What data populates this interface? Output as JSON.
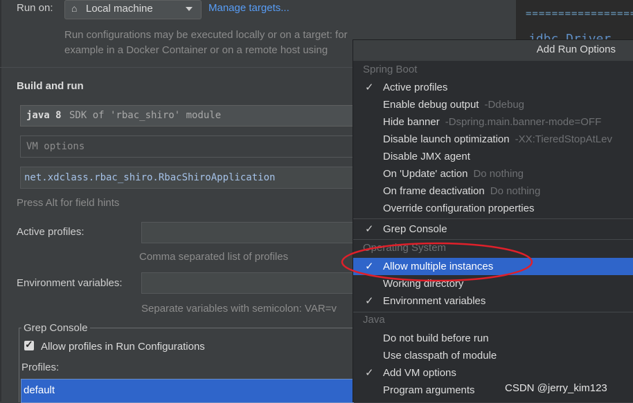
{
  "run_on": {
    "label": "Run on:",
    "target_value": "Local machine",
    "manage_link": "Manage targets...",
    "description_line1": "Run configurations may be executed locally or on a target: for",
    "description_line2": "example in a Docker Container or on a remote host using"
  },
  "build_and_run": {
    "heading": "Build and run",
    "sdk_prefix": "java 8",
    "sdk_rest": "SDK of 'rbac_shiro' module",
    "vm_options_placeholder": "VM options",
    "main_class": "net.xdclass.rbac_shiro.RbacShiroApplication",
    "field_hint": "Press Alt for field hints"
  },
  "active_profiles": {
    "label": "Active profiles:",
    "hint": "Comma separated list of profiles"
  },
  "environment_variables": {
    "label": "Environment variables:",
    "hint": "Separate variables with semicolon: VAR=v"
  },
  "grep_console": {
    "legend": "Grep Console",
    "allow_profiles_label": "Allow profiles in Run Configurations",
    "profiles_label": "Profiles:",
    "profile_selected": "default"
  },
  "editor": {
    "line1": "=====================",
    "line2": "jdbc.Driver"
  },
  "popup": {
    "title": "Add Run Options",
    "sections": {
      "spring_boot": "Spring Boot",
      "operating_system": "Operating System",
      "java": "Java"
    },
    "items": {
      "active_profiles": "Active profiles",
      "enable_debug_output": "Enable debug output",
      "enable_debug_output_hint": "-Ddebug",
      "hide_banner": "Hide banner",
      "hide_banner_hint": "-Dspring.main.banner-mode=OFF",
      "disable_launch_opt": "Disable launch optimization",
      "disable_launch_opt_hint": "-XX:TieredStopAtLev",
      "disable_jmx": "Disable JMX agent",
      "on_update": "On 'Update' action",
      "on_update_hint": "Do nothing",
      "on_frame": "On frame deactivation",
      "on_frame_hint": "Do nothing",
      "override_props": "Override configuration properties",
      "grep_console": "Grep Console",
      "allow_multiple": "Allow multiple instances",
      "working_dir": "Working directory",
      "env_vars": "Environment variables",
      "no_build": "Do not build before run",
      "use_classpath": "Use classpath of module",
      "add_vm": "Add VM options",
      "program_args": "Program arguments"
    },
    "check_glyph": "✓"
  },
  "watermark": "CSDN @jerry_kim123",
  "colors": {
    "panel_bg": "#3c3f41",
    "popup_bg": "#2b2d30",
    "selection": "#2f65ca",
    "link": "#589df6",
    "annotation": "#e0202a"
  }
}
